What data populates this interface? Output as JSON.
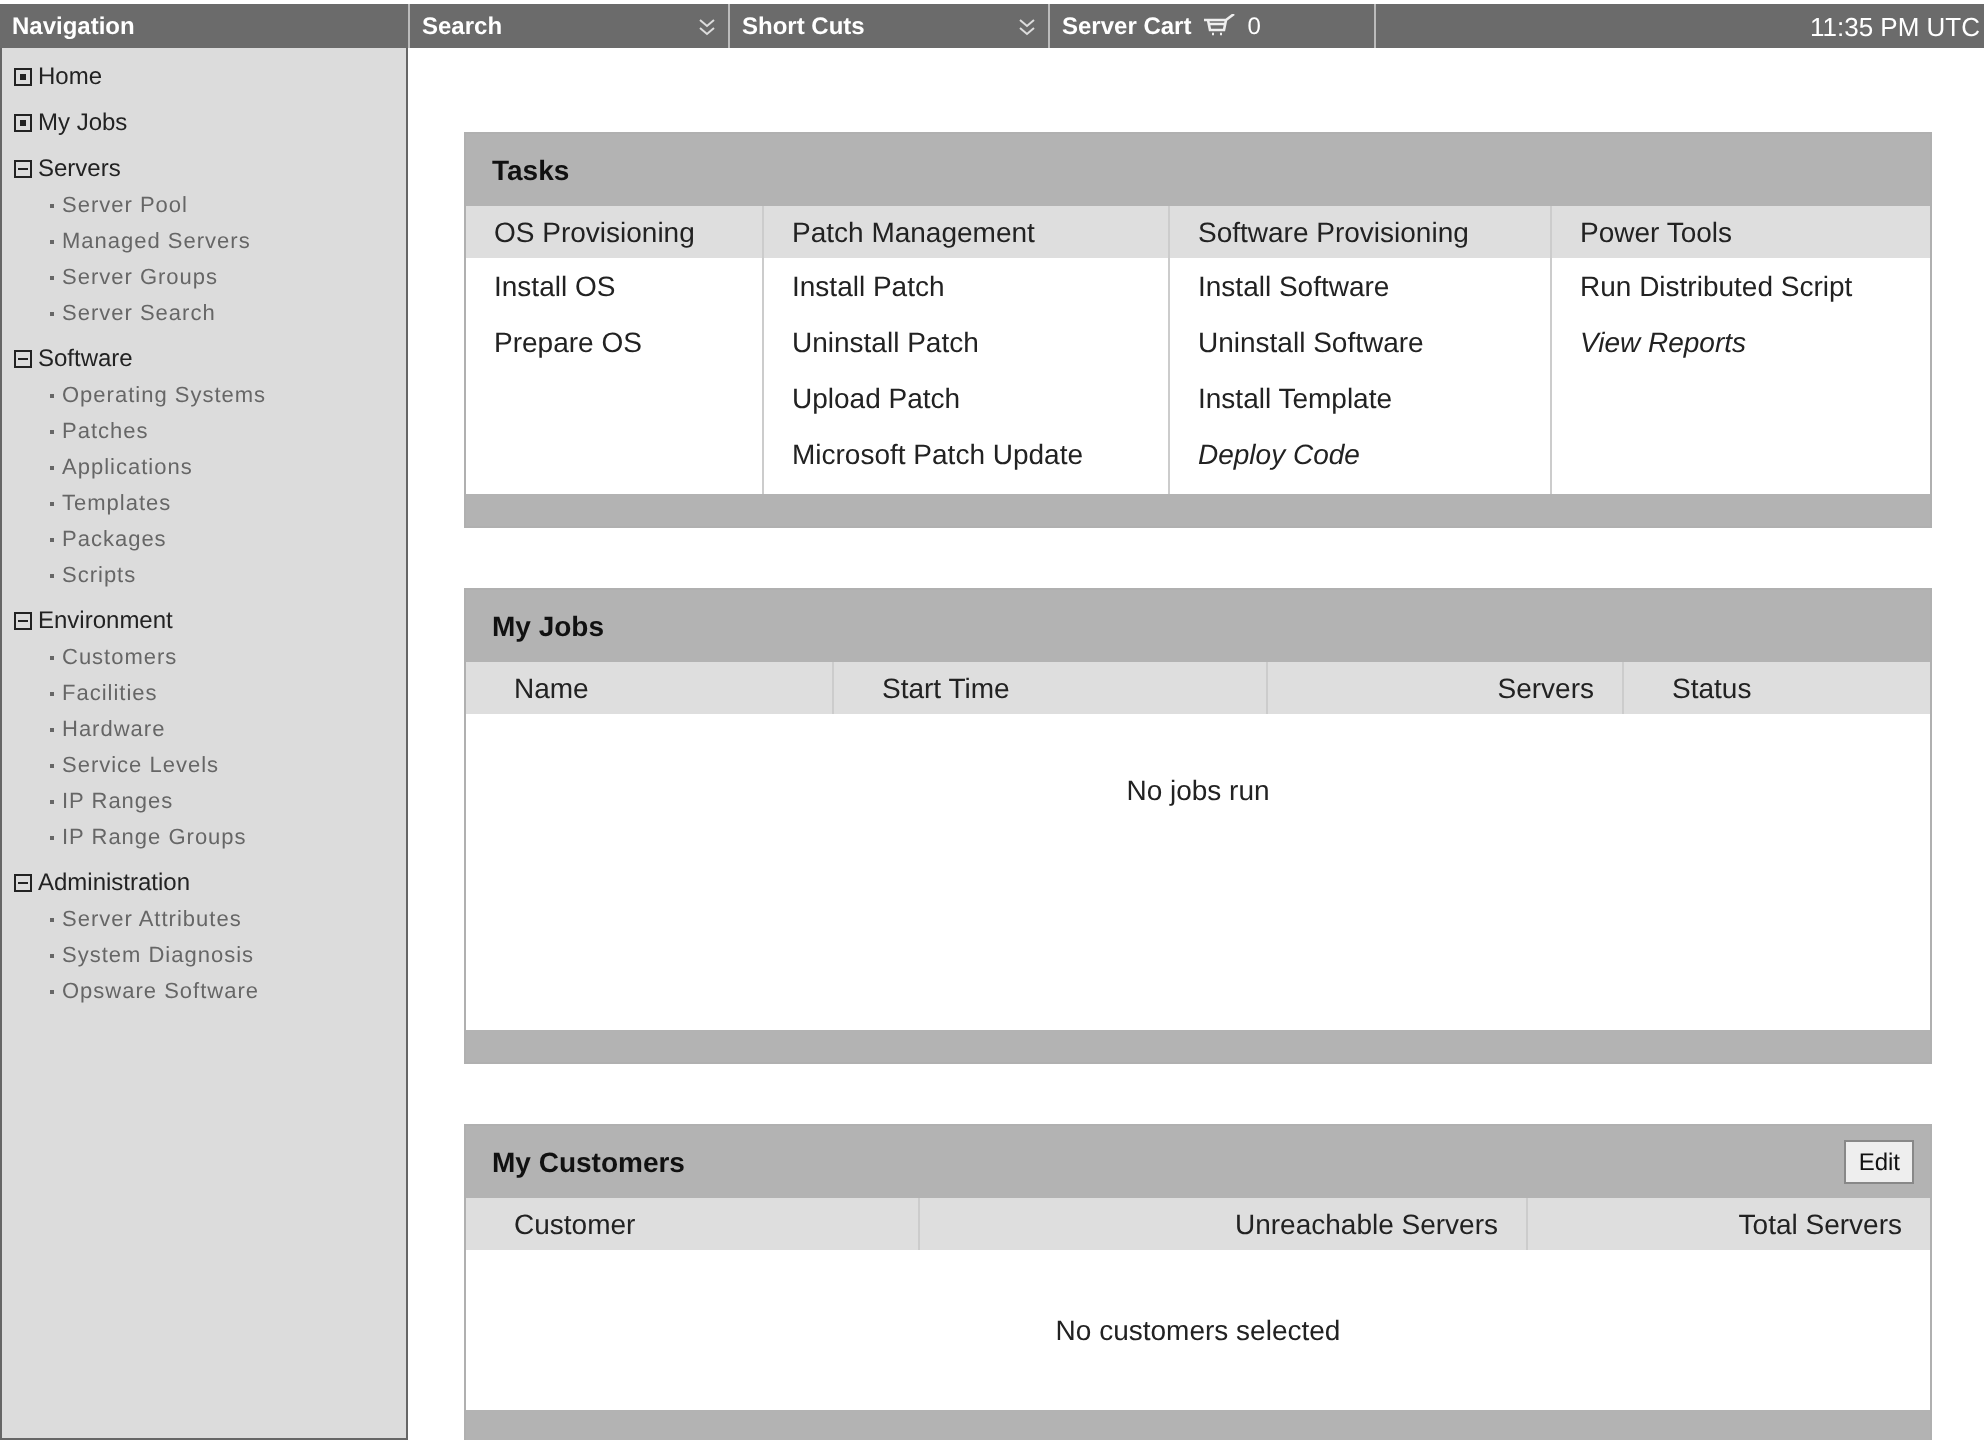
{
  "top_bar": {
    "navigation": "Navigation",
    "menus": [
      {
        "label": "Search"
      },
      {
        "label": "Short Cuts"
      }
    ],
    "cart": {
      "label": "Server Cart",
      "count": "0"
    },
    "time": "11:35 PM UTC"
  },
  "sidebar": {
    "items": [
      {
        "label": "Home",
        "kind": "leaf"
      },
      {
        "label": "My Jobs",
        "kind": "leaf"
      },
      {
        "label": "Servers",
        "kind": "section",
        "expanded": true,
        "children": [
          {
            "label": "Server Pool"
          },
          {
            "label": "Managed Servers"
          },
          {
            "label": "Server Groups"
          },
          {
            "label": "Server Search"
          }
        ]
      },
      {
        "label": "Software",
        "kind": "section",
        "expanded": true,
        "children": [
          {
            "label": "Operating Systems"
          },
          {
            "label": "Patches"
          },
          {
            "label": "Applications"
          },
          {
            "label": "Templates"
          },
          {
            "label": "Packages"
          },
          {
            "label": "Scripts"
          }
        ]
      },
      {
        "label": "Environment",
        "kind": "section",
        "expanded": true,
        "children": [
          {
            "label": "Customers"
          },
          {
            "label": "Facilities"
          },
          {
            "label": "Hardware"
          },
          {
            "label": "Service Levels"
          },
          {
            "label": "IP Ranges"
          },
          {
            "label": "IP Range Groups"
          }
        ]
      },
      {
        "label": "Administration",
        "kind": "section",
        "expanded": true,
        "children": [
          {
            "label": "Server Attributes"
          },
          {
            "label": "System Diagnosis"
          },
          {
            "label": "Opsware Software"
          }
        ]
      }
    ]
  },
  "tasks": {
    "title": "Tasks",
    "columns": [
      {
        "heading": "OS Provisioning",
        "links": [
          {
            "label": "Install OS",
            "italic": false
          },
          {
            "label": "Prepare OS",
            "italic": false
          }
        ]
      },
      {
        "heading": "Patch Management",
        "links": [
          {
            "label": "Install Patch",
            "italic": false
          },
          {
            "label": "Uninstall Patch",
            "italic": false
          },
          {
            "label": "Upload Patch",
            "italic": false
          },
          {
            "label": "Microsoft Patch Update",
            "italic": false
          }
        ]
      },
      {
        "heading": "Software Provisioning",
        "links": [
          {
            "label": "Install Software",
            "italic": false
          },
          {
            "label": "Uninstall Software",
            "italic": false
          },
          {
            "label": "Install Template",
            "italic": false
          },
          {
            "label": "Deploy Code",
            "italic": true
          }
        ]
      },
      {
        "heading": "Power Tools",
        "links": [
          {
            "label": "Run Distributed Script",
            "italic": false
          },
          {
            "label": "View Reports",
            "italic": true
          }
        ]
      }
    ]
  },
  "my_jobs": {
    "title": "My Jobs",
    "columns": [
      {
        "label": "Name",
        "kind": "text"
      },
      {
        "label": "Start Time",
        "kind": "text"
      },
      {
        "label": "Servers",
        "kind": "number"
      },
      {
        "label": "Status",
        "kind": "text"
      }
    ],
    "empty_message": "No jobs run"
  },
  "my_customers": {
    "title": "My Customers",
    "edit_button": "Edit",
    "columns": [
      {
        "label": "Customer",
        "kind": "text"
      },
      {
        "label": "Unreachable Servers",
        "kind": "number"
      },
      {
        "label": "Total Servers",
        "kind": "number"
      }
    ],
    "empty_message": "No customers selected"
  }
}
